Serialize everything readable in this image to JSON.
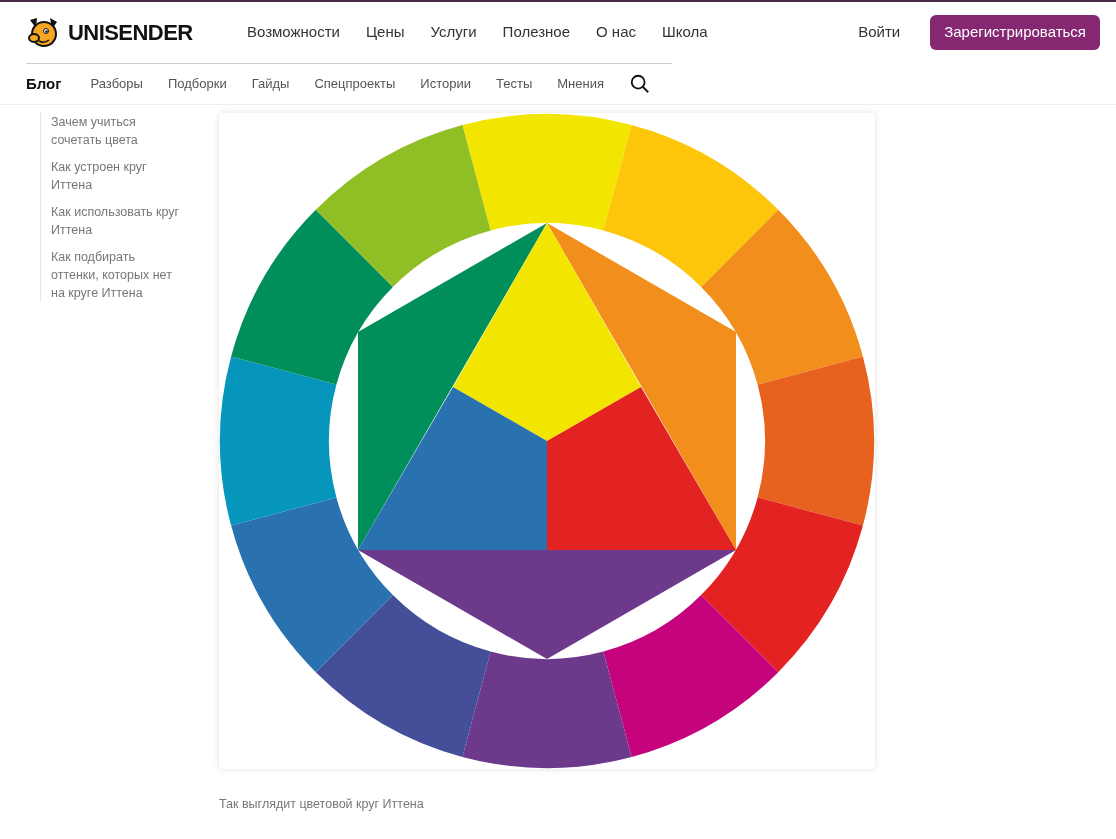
{
  "header": {
    "brand": "UNISENDER",
    "nav": [
      "Возможности",
      "Цены",
      "Услуги",
      "Полезное",
      "О нас",
      "Школа"
    ],
    "login": "Войти",
    "register": "Зарегистрироваться"
  },
  "subnav": [
    {
      "label": "Блог",
      "selected": true
    },
    {
      "label": "Разборы",
      "selected": false
    },
    {
      "label": "Подборки",
      "selected": false
    },
    {
      "label": "Гайды",
      "selected": false
    },
    {
      "label": "Спецпроекты",
      "selected": false
    },
    {
      "label": "Истории",
      "selected": false
    },
    {
      "label": "Тесты",
      "selected": false
    },
    {
      "label": "Мнения",
      "selected": false
    }
  ],
  "toc": [
    "Зачем учиться сочетать цвета",
    "Как устроен круг Иттена",
    "Как использовать круг Иттена",
    "Как подбирать оттенки, которых нет на круге Иттена"
  ],
  "figure": {
    "caption": "Так выглядит цветовой круг Иттена"
  }
}
